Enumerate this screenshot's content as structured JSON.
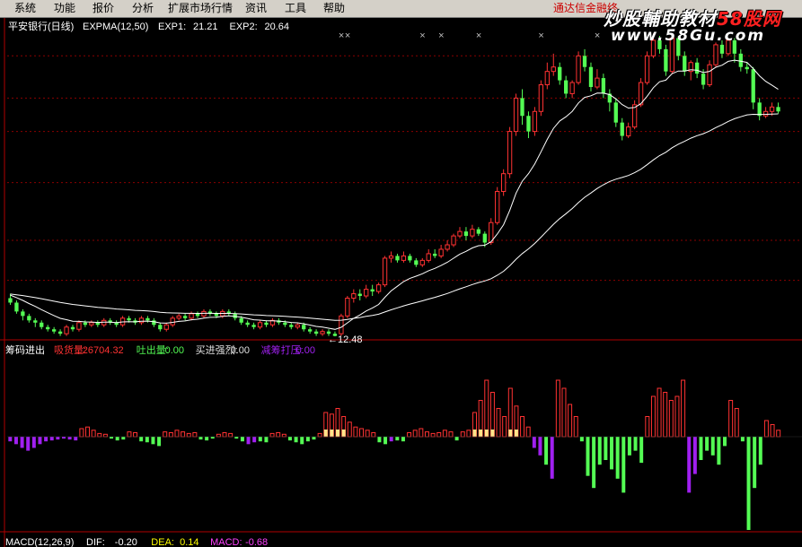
{
  "menu": {
    "items": [
      "系统",
      "功能",
      "报价",
      "分析",
      "扩展市场行情",
      "资讯",
      "工具",
      "帮助"
    ],
    "right_text": "通达信金融终"
  },
  "watermark": {
    "text_a": "炒股輔助教材",
    "text_b": "58股网",
    "url": "www.58Gu.com"
  },
  "colors": {
    "up": "#ff3232",
    "down": "#54fc54",
    "line": "#ffffff",
    "grid": "#8a0000",
    "purple": "#a020f0",
    "yellow": "#ffe58a",
    "axis": "#b00000"
  },
  "chart_data": [
    {
      "type": "candlestick",
      "title": "平安银行(日线)",
      "indicator": "EXPMA(12,50)",
      "legend": [
        {
          "label": "EXP1:",
          "value": "21.21",
          "color": "#ffffff"
        },
        {
          "label": "EXP2:",
          "value": "20.64",
          "color": "#ffffff"
        }
      ],
      "low_annotation": "←12.48",
      "low_index": 52,
      "ylim": [
        11.8,
        26.0
      ],
      "y_grid": [
        25.1,
        23.2,
        21.7,
        19.4,
        16.8,
        15.0
      ],
      "x_marker_indices": [
        53,
        54,
        66,
        69,
        75,
        85,
        94
      ],
      "candles": [
        [
          14.2,
          14.0,
          14.4,
          13.9
        ],
        [
          14.0,
          13.6,
          14.1,
          13.5
        ],
        [
          13.6,
          13.4,
          13.7,
          13.2
        ],
        [
          13.4,
          13.2,
          13.5,
          13.1
        ],
        [
          13.2,
          13.1,
          13.3,
          12.9
        ],
        [
          13.1,
          12.9,
          13.2,
          12.8
        ],
        [
          12.9,
          12.8,
          13.0,
          12.7
        ],
        [
          12.8,
          12.7,
          12.9,
          12.6
        ],
        [
          12.7,
          12.6,
          12.8,
          12.5
        ],
        [
          12.6,
          12.9,
          13.0,
          12.5
        ],
        [
          12.9,
          12.8,
          13.0,
          12.7
        ],
        [
          12.8,
          13.1,
          13.2,
          12.7
        ],
        [
          13.1,
          13.0,
          13.2,
          12.9
        ],
        [
          13.0,
          13.1,
          13.2,
          12.9
        ],
        [
          13.1,
          13.0,
          13.2,
          12.9
        ],
        [
          13.0,
          13.2,
          13.3,
          12.9
        ],
        [
          13.2,
          13.1,
          13.3,
          13.0
        ],
        [
          13.1,
          13.0,
          13.2,
          12.9
        ],
        [
          13.0,
          13.3,
          13.4,
          12.9
        ],
        [
          13.3,
          13.2,
          13.4,
          13.1
        ],
        [
          13.2,
          13.1,
          13.3,
          13.0
        ],
        [
          13.1,
          13.3,
          13.4,
          13.0
        ],
        [
          13.3,
          13.2,
          13.4,
          13.1
        ],
        [
          13.2,
          13.0,
          13.3,
          12.9
        ],
        [
          13.0,
          12.8,
          13.1,
          12.7
        ],
        [
          12.8,
          13.0,
          13.1,
          12.7
        ],
        [
          13.0,
          13.3,
          13.4,
          12.9
        ],
        [
          13.3,
          13.4,
          13.5,
          13.2
        ],
        [
          13.4,
          13.3,
          13.5,
          13.2
        ],
        [
          13.3,
          13.5,
          13.6,
          13.2
        ],
        [
          13.5,
          13.4,
          13.6,
          13.3
        ],
        [
          13.4,
          13.6,
          13.7,
          13.3
        ],
        [
          13.6,
          13.5,
          13.7,
          13.4
        ],
        [
          13.5,
          13.4,
          13.6,
          13.3
        ],
        [
          13.4,
          13.6,
          13.7,
          13.3
        ],
        [
          13.6,
          13.5,
          13.7,
          13.4
        ],
        [
          13.5,
          13.3,
          13.6,
          13.2
        ],
        [
          13.3,
          13.1,
          13.4,
          13.0
        ],
        [
          13.1,
          13.0,
          13.2,
          12.9
        ],
        [
          13.0,
          12.9,
          13.1,
          12.8
        ],
        [
          12.9,
          13.1,
          13.2,
          12.8
        ],
        [
          13.1,
          13.0,
          13.2,
          12.9
        ],
        [
          13.0,
          13.2,
          13.3,
          12.9
        ],
        [
          13.2,
          13.1,
          13.3,
          13.0
        ],
        [
          13.1,
          13.0,
          13.2,
          12.9
        ],
        [
          13.0,
          12.9,
          13.1,
          12.8
        ],
        [
          12.9,
          13.0,
          13.1,
          12.8
        ],
        [
          13.0,
          12.8,
          13.1,
          12.7
        ],
        [
          12.8,
          12.7,
          12.9,
          12.6
        ],
        [
          12.7,
          12.6,
          12.8,
          12.5
        ],
        [
          12.6,
          12.7,
          12.8,
          12.5
        ],
        [
          12.7,
          12.6,
          12.8,
          12.5
        ],
        [
          12.6,
          12.5,
          12.7,
          12.48
        ],
        [
          12.6,
          13.4,
          13.5,
          12.5
        ],
        [
          13.4,
          14.2,
          14.3,
          13.3
        ],
        [
          14.2,
          14.4,
          14.6,
          14.0
        ],
        [
          14.4,
          14.3,
          14.6,
          14.1
        ],
        [
          14.3,
          14.6,
          14.8,
          14.2
        ],
        [
          14.6,
          14.5,
          14.8,
          14.3
        ],
        [
          14.5,
          14.8,
          14.9,
          14.4
        ],
        [
          14.8,
          16.0,
          16.1,
          14.7
        ],
        [
          16.0,
          16.1,
          16.3,
          15.8
        ],
        [
          16.1,
          15.9,
          16.2,
          15.8
        ],
        [
          15.9,
          16.1,
          16.3,
          15.8
        ],
        [
          16.1,
          15.9,
          16.2,
          15.8
        ],
        [
          15.9,
          15.7,
          16.0,
          15.6
        ],
        [
          15.7,
          15.9,
          16.0,
          15.6
        ],
        [
          15.9,
          16.2,
          16.4,
          15.8
        ],
        [
          16.2,
          16.1,
          16.4,
          16.0
        ],
        [
          16.1,
          16.4,
          16.6,
          16.0
        ],
        [
          16.4,
          16.6,
          16.8,
          16.3
        ],
        [
          16.6,
          17.0,
          17.1,
          16.5
        ],
        [
          17.0,
          17.2,
          17.4,
          16.9
        ],
        [
          17.2,
          17.0,
          17.4,
          16.8
        ],
        [
          17.0,
          17.3,
          17.5,
          16.9
        ],
        [
          17.3,
          17.1,
          17.4,
          17.0
        ],
        [
          17.1,
          16.7,
          17.2,
          16.5
        ],
        [
          16.7,
          17.6,
          17.8,
          16.6
        ],
        [
          17.6,
          19.0,
          19.2,
          17.5
        ],
        [
          19.0,
          19.8,
          20.0,
          18.8
        ],
        [
          19.8,
          21.7,
          21.9,
          19.6
        ],
        [
          21.7,
          23.2,
          23.4,
          21.5
        ],
        [
          23.2,
          22.4,
          23.6,
          22.0
        ],
        [
          22.4,
          21.7,
          22.6,
          21.4
        ],
        [
          21.7,
          22.6,
          22.8,
          21.5
        ],
        [
          22.6,
          23.8,
          24.0,
          22.4
        ],
        [
          23.8,
          24.4,
          24.8,
          23.6
        ],
        [
          24.4,
          24.6,
          25.2,
          24.2
        ],
        [
          24.6,
          24.0,
          24.8,
          23.8
        ],
        [
          24.0,
          23.4,
          24.2,
          23.2
        ],
        [
          23.4,
          23.9,
          24.0,
          23.2
        ],
        [
          23.9,
          25.1,
          25.3,
          23.8
        ],
        [
          25.1,
          24.6,
          25.4,
          24.4
        ],
        [
          24.6,
          23.7,
          24.8,
          23.5
        ],
        [
          23.7,
          24.1,
          24.5,
          23.6
        ],
        [
          24.1,
          23.4,
          24.3,
          23.2
        ],
        [
          23.4,
          23.0,
          23.6,
          22.6
        ],
        [
          23.0,
          22.1,
          23.2,
          21.9
        ],
        [
          22.1,
          21.5,
          22.3,
          21.3
        ],
        [
          21.5,
          21.9,
          22.1,
          21.4
        ],
        [
          21.9,
          22.9,
          23.1,
          21.8
        ],
        [
          22.9,
          23.9,
          24.1,
          22.8
        ],
        [
          23.9,
          25.1,
          25.3,
          23.8
        ],
        [
          25.1,
          25.8,
          26.1,
          25.0
        ],
        [
          25.8,
          25.4,
          26.0,
          25.2
        ],
        [
          25.4,
          24.4,
          25.6,
          24.2
        ],
        [
          24.4,
          25.9,
          26.0,
          24.3
        ],
        [
          25.9,
          25.1,
          26.0,
          24.9
        ],
        [
          25.1,
          24.4,
          25.3,
          24.2
        ],
        [
          24.4,
          24.8,
          24.9,
          24.0
        ],
        [
          24.8,
          24.3,
          25.0,
          24.1
        ],
        [
          24.3,
          23.8,
          24.5,
          23.6
        ],
        [
          23.8,
          24.7,
          24.9,
          23.7
        ],
        [
          24.7,
          25.6,
          25.7,
          24.6
        ],
        [
          25.6,
          25.2,
          25.8,
          25.0
        ],
        [
          25.2,
          25.8,
          25.9,
          25.1
        ],
        [
          25.8,
          25.2,
          25.9,
          24.8
        ],
        [
          25.2,
          24.6,
          25.4,
          24.4
        ],
        [
          24.6,
          24.5,
          24.8,
          24.3
        ],
        [
          24.5,
          23.0,
          24.6,
          22.7
        ],
        [
          23.0,
          22.4,
          23.2,
          22.2
        ],
        [
          22.4,
          22.6,
          22.8,
          22.3
        ],
        [
          22.6,
          22.8,
          23.0,
          22.4
        ],
        [
          22.8,
          22.6,
          23.0,
          22.5
        ]
      ]
    },
    {
      "type": "bar",
      "title": "筹码进出",
      "legend": [
        {
          "label": "吸货量:",
          "value": "26704.32",
          "color": "#ff3232"
        },
        {
          "label": "吐出量:",
          "value": "0.00",
          "color": "#54fc54"
        },
        {
          "label": "买进强烈:",
          "value": "0.00",
          "color": "#e0e0e0"
        },
        {
          "label": "减筹打压:",
          "value": "0.00",
          "color": "#a020f0"
        }
      ],
      "ylim": [
        -1,
        1
      ],
      "values": [
        -0.05,
        -0.08,
        -0.12,
        -0.15,
        -0.12,
        -0.08,
        -0.05,
        -0.04,
        -0.03,
        -0.02,
        -0.03,
        -0.04,
        0.1,
        0.12,
        0.08,
        0.04,
        0.03,
        -0.02,
        -0.04,
        -0.03,
        0.06,
        0.05,
        -0.05,
        -0.06,
        -0.08,
        -0.1,
        0.06,
        0.05,
        0.08,
        0.06,
        0.04,
        0.05,
        -0.03,
        -0.04,
        -0.02,
        0.03,
        0.05,
        0.04,
        -0.02,
        -0.05,
        -0.08,
        -0.06,
        -0.05,
        -0.06,
        0.04,
        0.05,
        0.03,
        -0.04,
        -0.06,
        -0.08,
        -0.05,
        -0.03,
        0.04,
        0.3,
        0.28,
        0.35,
        0.25,
        0.18,
        0.12,
        0.1,
        0.08,
        0.05,
        -0.06,
        -0.08,
        -0.05,
        -0.04,
        -0.05,
        0.05,
        0.08,
        0.1,
        0.06,
        0.04,
        0.05,
        0.08,
        0.06,
        -0.04,
        0.06,
        0.08,
        0.3,
        0.45,
        0.7,
        0.55,
        0.35,
        0.25,
        0.6,
        0.38,
        0.25,
        0.12,
        -0.12,
        -0.2,
        -0.3,
        -0.45,
        0.7,
        0.6,
        0.4,
        0.25,
        -0.05,
        -0.42,
        -0.55,
        -0.3,
        -0.25,
        -0.35,
        -0.45,
        -0.6,
        -0.2,
        -0.15,
        -0.28,
        0.25,
        0.5,
        0.6,
        0.55,
        0.45,
        0.5,
        0.7,
        -0.6,
        -0.4,
        -0.25,
        -0.15,
        -0.2,
        -0.3,
        -0.1,
        0.45,
        0.35,
        -0.05,
        -1.0,
        -0.55,
        -0.3,
        0.2,
        0.15,
        0.08
      ],
      "bar_types": [
        "p",
        "p",
        "p",
        "p",
        "p",
        "p",
        "p",
        "p",
        "p",
        "p",
        "p",
        "p",
        "r",
        "r",
        "r",
        "r",
        "r",
        "g",
        "g",
        "g",
        "r",
        "r",
        "g",
        "g",
        "g",
        "g",
        "r",
        "r",
        "r",
        "r",
        "r",
        "r",
        "g",
        "g",
        "g",
        "r",
        "r",
        "r",
        "g",
        "g",
        "p",
        "p",
        "g",
        "g",
        "r",
        "r",
        "r",
        "g",
        "g",
        "g",
        "g",
        "g",
        "r",
        "ry",
        "ry",
        "ry",
        "ry",
        "r",
        "r",
        "r",
        "r",
        "r",
        "g",
        "g",
        "p",
        "g",
        "g",
        "r",
        "r",
        "r",
        "r",
        "r",
        "r",
        "r",
        "r",
        "g",
        "r",
        "r",
        "ry",
        "ry",
        "ry",
        "ry",
        "r",
        "r",
        "ry",
        "ry",
        "r",
        "r",
        "p",
        "p",
        "g",
        "p",
        "r",
        "r",
        "r",
        "r",
        "g",
        "g",
        "g",
        "g",
        "g",
        "g",
        "g",
        "g",
        "g",
        "g",
        "g",
        "r",
        "r",
        "r",
        "r",
        "r",
        "r",
        "r",
        "p",
        "p",
        "g",
        "g",
        "g",
        "g",
        "g",
        "r",
        "r",
        "g",
        "g",
        "g",
        "g",
        "r",
        "r",
        "r"
      ]
    },
    {
      "type": "indicator_legend",
      "title": "MACD(12,26,9)",
      "legend": [
        {
          "label": "DIF:",
          "value": "-0.20",
          "color": "#ffffff"
        },
        {
          "label": "DEA:",
          "value": "0.14",
          "color": "#ffff00"
        },
        {
          "label": "MACD:",
          "value": "-0.68",
          "color": "#ff40ff"
        }
      ]
    }
  ]
}
